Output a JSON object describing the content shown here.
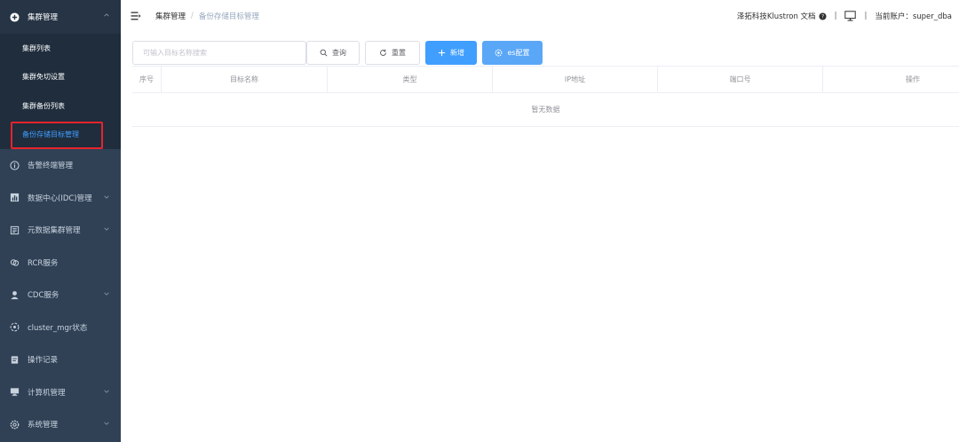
{
  "sidebar": {
    "group": {
      "label": "集群管理",
      "icon": "plus-circle-icon"
    },
    "sub_items": [
      {
        "label": "集群列表"
      },
      {
        "label": "集群免切设置"
      },
      {
        "label": "集群备份列表"
      },
      {
        "label": "备份存储目标管理",
        "active": true
      }
    ],
    "items": [
      {
        "label": "告警终端管理",
        "icon": "info-circle-icon",
        "chevron": false
      },
      {
        "label": "数据中心(IDC)管理",
        "icon": "chart-icon",
        "chevron": true
      },
      {
        "label": "元数据集群管理",
        "icon": "metadata-icon",
        "chevron": true
      },
      {
        "label": "RCR服务",
        "icon": "link-icon",
        "chevron": false
      },
      {
        "label": "CDC服务",
        "icon": "user-icon",
        "chevron": true
      },
      {
        "label": "cluster_mgr状态",
        "icon": "status-icon",
        "chevron": false
      },
      {
        "label": "操作记录",
        "icon": "record-icon",
        "chevron": false
      },
      {
        "label": "计算机管理",
        "icon": "computer-icon",
        "chevron": true
      },
      {
        "label": "系统管理",
        "icon": "settings-icon",
        "chevron": true
      }
    ]
  },
  "navbar": {
    "breadcrumb_root": "集群管理",
    "breadcrumb_sep": "/",
    "breadcrumb_current": "备份存储目标管理",
    "docs_link": "泽拓科技Klustron 文档",
    "divider": "|",
    "account_label": "当前账户：super_dba"
  },
  "toolbar": {
    "search_placeholder": "可输入目标名称搜索",
    "search_value": "",
    "query_label": "查询",
    "reset_label": "重置",
    "add_label": "新增",
    "es_label": "es配置"
  },
  "table": {
    "columns": [
      "序号",
      "目标名称",
      "类型",
      "IP地址",
      "端口号",
      "操作"
    ],
    "empty_text": "暂无数据"
  },
  "colors": {
    "sidebar_bg": "#304156",
    "active": "#409eff",
    "highlight_box": "#e7242b"
  }
}
